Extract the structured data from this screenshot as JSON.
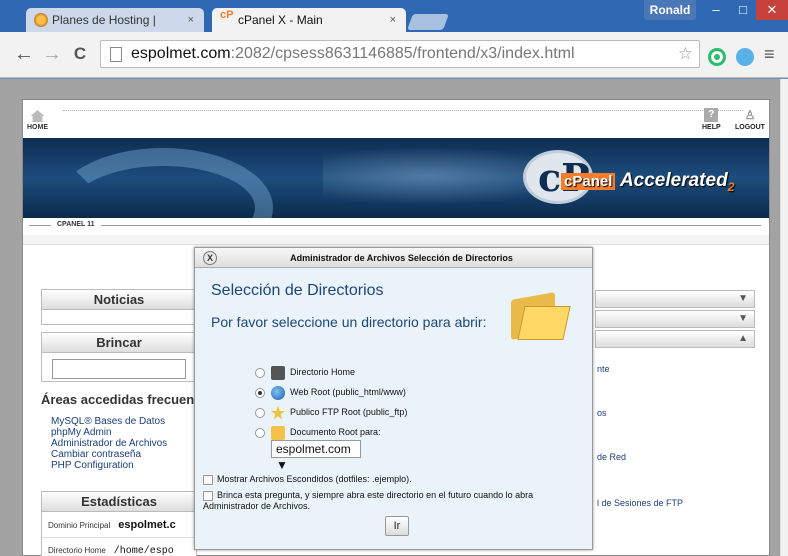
{
  "browser": {
    "tabs": [
      {
        "label": "Planes de Hosting |",
        "close": "×"
      },
      {
        "label": "cPanel X - Main",
        "close": "×",
        "icon_text": "cP"
      }
    ],
    "user": "Ronald",
    "window_controls": {
      "min": "–",
      "max": "□",
      "close": "✕"
    },
    "nav": {
      "back": "←",
      "forward": "→",
      "reload": "C"
    },
    "url": {
      "domain": "espolmet.com",
      "path": ":2082/cpsess8631146885/frontend/x3/index.html"
    },
    "star": "☆",
    "menu": "≡"
  },
  "cpanel": {
    "home_label": "HOME",
    "help_label": "HELP",
    "logout_label": "LOGOUT",
    "help_icon": "?",
    "logout_icon": "♙",
    "logo": {
      "cp": "cP",
      "brand": "cPanel",
      "accelerated": "Accelerated",
      "sub": "2"
    },
    "version_label": "CPANEL 11",
    "left_boxes": {
      "noticias": "Noticias",
      "brincar": "Brincar",
      "areas_title": "Áreas accedidas frecuen",
      "areas_links": [
        "MySQL® Bases de Datos",
        "phpMy Admin",
        "Administrador de Archivos",
        "Cambiar contraseña",
        "PHP Configuration"
      ],
      "estadisticas": "Estadísticas",
      "stats": [
        {
          "label": "Dominio Principal",
          "value": "espolmet.c"
        },
        {
          "label": "Directorio Home",
          "value": "/home/espo"
        }
      ]
    },
    "right_boxes": {
      "arrows": [
        "▼",
        "▼",
        "▲"
      ]
    },
    "mid_texts": [
      "nte",
      "os",
      "de Red",
      "l de Sesiones de FTP"
    ]
  },
  "dialog": {
    "close": "X",
    "header": "Administrador de Archivos Selección de Directorios",
    "title": "Selección de Directorios",
    "subtitle": "Por favor seleccione un directorio para abrir:",
    "options": [
      {
        "label": "Directorio Home",
        "selected": false
      },
      {
        "label": "Web Root (public_html/www)",
        "selected": true
      },
      {
        "label": "Publico FTP Root (public_ftp)",
        "selected": false
      },
      {
        "label": "Documento Root para:",
        "selected": false
      }
    ],
    "domain_select": "espolmet.com ▼",
    "show_hidden": "Mostrar Archivos Escondidos (dotfiles: .ejemplo).",
    "skip_question": "Brinca esta pregunta, y siempre abra este directorio en el futuro cuando lo abra Administrador de Archivos.",
    "go_button": "Ir"
  },
  "colors": {
    "titlebar": "#2f68b3",
    "close_button": "#c7413b",
    "accent_orange": "#f47c2a",
    "dialog_bg": "#eaf3f9"
  }
}
